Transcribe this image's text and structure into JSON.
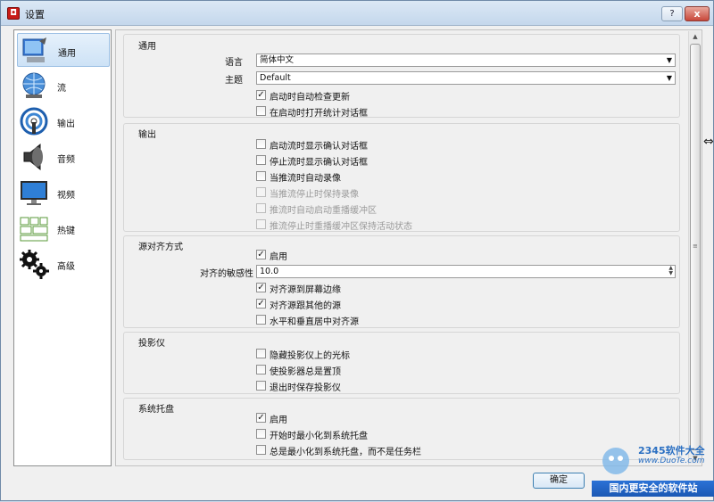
{
  "window": {
    "title": "设置",
    "help": "?",
    "close": "x"
  },
  "sidebar": {
    "items": [
      {
        "label": "通用",
        "icon": "general-settings-icon",
        "active": true
      },
      {
        "label": "流",
        "icon": "stream-globe-icon"
      },
      {
        "label": "输出",
        "icon": "output-broadcast-icon"
      },
      {
        "label": "音频",
        "icon": "audio-speaker-icon"
      },
      {
        "label": "视频",
        "icon": "video-monitor-icon"
      },
      {
        "label": "热键",
        "icon": "hotkeys-keyboard-icon"
      },
      {
        "label": "高级",
        "icon": "advanced-gears-icon"
      }
    ]
  },
  "general": {
    "title": "通用",
    "language_label": "语言",
    "language_value": "简体中文",
    "theme_label": "主题",
    "theme_value": "Default",
    "check_updates": "启动时自动检查更新",
    "open_stats": "在启动时打开统计对话框"
  },
  "output": {
    "title": "输出",
    "items": [
      {
        "label": "启动流时显示确认对话框",
        "checked": false,
        "enabled": true
      },
      {
        "label": "停止流时显示确认对话框",
        "checked": false,
        "enabled": true
      },
      {
        "label": "当推流时自动录像",
        "checked": false,
        "enabled": true
      },
      {
        "label": "当推流停止时保持录像",
        "checked": false,
        "enabled": false
      },
      {
        "label": "推流时自动启动重播缓冲区",
        "checked": false,
        "enabled": false
      },
      {
        "label": "推流停止时重播缓冲区保持活动状态",
        "checked": false,
        "enabled": false
      }
    ]
  },
  "snapping": {
    "title": "源对齐方式",
    "enable": "启用",
    "sensitivity_label": "对齐的敏感性",
    "sensitivity_value": "10.0",
    "snap_screen": "对齐源到屏幕边缘",
    "snap_other": "对齐源跟其他的源",
    "snap_center": "水平和垂直居中对齐源"
  },
  "projector": {
    "title": "投影仪",
    "hide_cursor": "隐藏投影仪上的光标",
    "always_top": "使投影器总是置顶",
    "save_exit": "退出时保存投影仪"
  },
  "tray": {
    "title": "系统托盘",
    "enable": "启用",
    "minimize_start": "开始时最小化到系统托盘",
    "always_minimize": "总是最小化到系统托盘，而不是任务栏"
  },
  "buttons": {
    "ok": "确定"
  },
  "watermark": {
    "logo": "2345软件大全",
    "url": "www.DuoTe.com",
    "banner": "国内更安全的软件站"
  },
  "colors": {
    "accent": "#3c7fb1",
    "title_bar": "#c4d7ec",
    "watermark_blue": "#1b58b4"
  }
}
